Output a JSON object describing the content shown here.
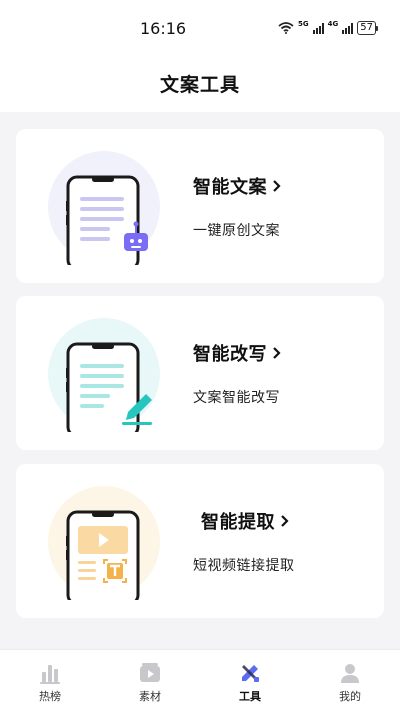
{
  "status": {
    "time": "16:16",
    "network_1": "5G",
    "network_2": "4G",
    "battery": "57"
  },
  "header": {
    "title": "文案工具"
  },
  "cards": [
    {
      "title": "智能文案",
      "subtitle": "一键原创文案",
      "icon": "robot-icon",
      "accent": "#7b6cf6"
    },
    {
      "title": "智能改写",
      "subtitle": "文案智能改写",
      "icon": "pencil-icon",
      "accent": "#27c5c0"
    },
    {
      "title": "智能提取",
      "subtitle": "短视频链接提取",
      "icon": "text-extract-icon",
      "accent": "#f5b24a"
    }
  ],
  "tabbar": {
    "items": [
      {
        "label": "热榜",
        "icon": "bar-chart-icon",
        "active": false
      },
      {
        "label": "素材",
        "icon": "video-icon",
        "active": false
      },
      {
        "label": "工具",
        "icon": "tools-icon",
        "active": true
      },
      {
        "label": "我的",
        "icon": "user-icon",
        "active": false
      }
    ]
  }
}
